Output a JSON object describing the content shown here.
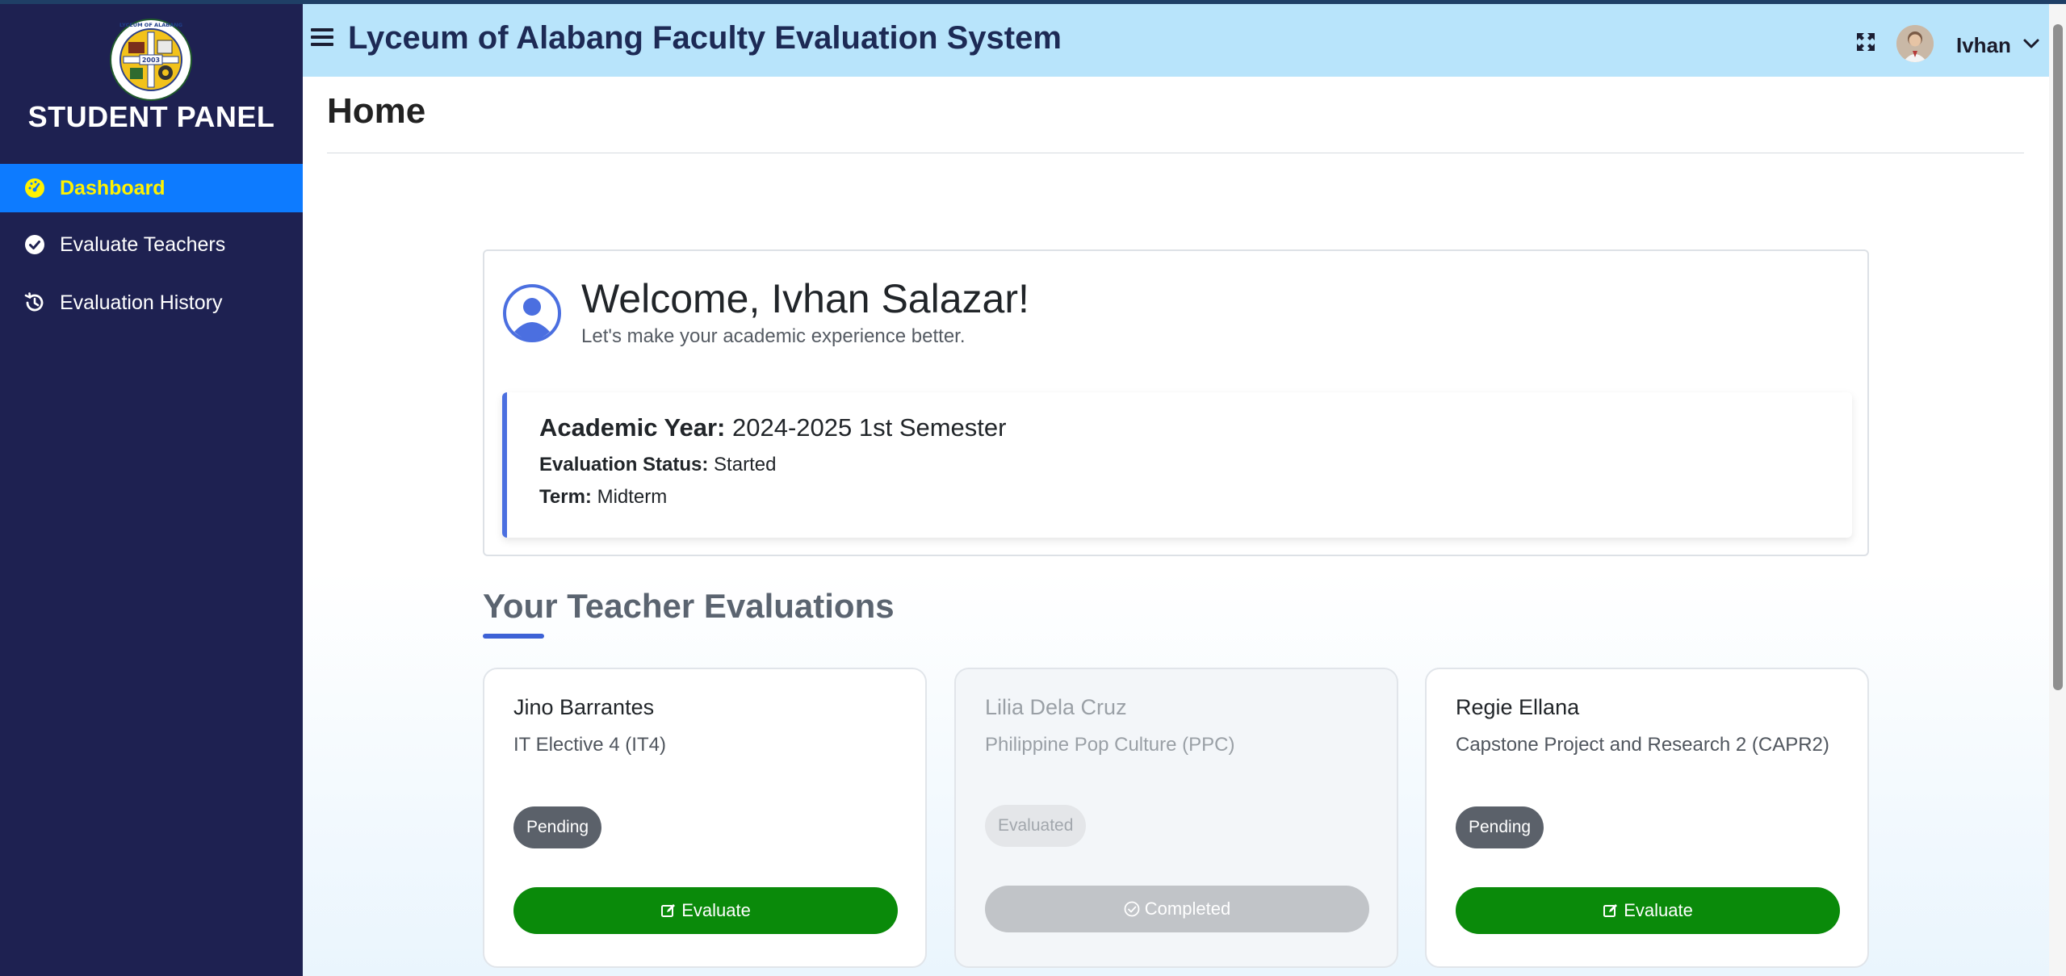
{
  "sidebar": {
    "panel_title": "STUDENT PANEL",
    "logo_text": "LYCEUM OF ALABANG",
    "logo_year": "2003",
    "items": [
      {
        "label": "Dashboard",
        "icon": "dashboard-gauge-icon",
        "active": true
      },
      {
        "label": "Evaluate Teachers",
        "icon": "check-circle-icon",
        "active": false
      },
      {
        "label": "Evaluation History",
        "icon": "history-icon",
        "active": false
      }
    ]
  },
  "header": {
    "title": "Lyceum of Alabang Faculty Evaluation System",
    "user_name": "Ivhan",
    "background": "#b8e4fb"
  },
  "page": {
    "title": "Home"
  },
  "welcome": {
    "heading": "Welcome, Ivhan Salazar!",
    "subtitle": "Let's make your academic experience better.",
    "academic_year_label": "Academic Year:",
    "academic_year_value": "2024-2025 1st Semester",
    "status_label": "Evaluation Status:",
    "status_value": "Started",
    "term_label": "Term:",
    "term_value": "Midterm"
  },
  "evaluations": {
    "section_title": "Your Teacher Evaluations",
    "cards": [
      {
        "teacher": "Jino Barrantes",
        "subject": "IT Elective 4 (IT4)",
        "status": "Pending",
        "action": "Evaluate"
      },
      {
        "teacher": "Lilia Dela Cruz",
        "subject": "Philippine Pop Culture (PPC)",
        "status": "Evaluated",
        "action": "Completed"
      },
      {
        "teacher": "Regie Ellana",
        "subject": "Capstone Project and Research 2 (CAPR2)",
        "status": "Pending",
        "action": "Evaluate"
      }
    ]
  },
  "colors": {
    "sidebar": "#1e2151",
    "active_nav": "#0d7bff",
    "active_nav_text": "#fff200",
    "evaluate_button": "#0a8a0a",
    "accent": "#3d62d6"
  }
}
